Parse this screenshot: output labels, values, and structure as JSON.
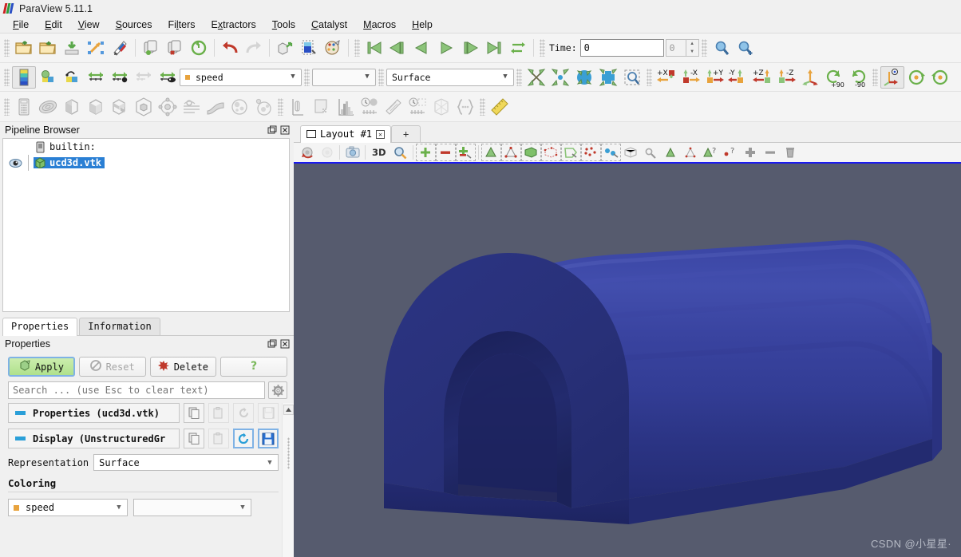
{
  "window": {
    "title": "ParaView 5.11.1",
    "logo_icon": "paraview-logo-icon"
  },
  "menubar": {
    "items": [
      {
        "label": "File",
        "mnemonic": "F"
      },
      {
        "label": "Edit",
        "mnemonic": "E"
      },
      {
        "label": "View",
        "mnemonic": "V"
      },
      {
        "label": "Sources",
        "mnemonic": "S"
      },
      {
        "label": "Filters",
        "mnemonic": "l"
      },
      {
        "label": "Extractors",
        "mnemonic": "x"
      },
      {
        "label": "Tools",
        "mnemonic": "T"
      },
      {
        "label": "Catalyst",
        "mnemonic": "C"
      },
      {
        "label": "Macros",
        "mnemonic": "M"
      },
      {
        "label": "Help",
        "mnemonic": "H"
      }
    ]
  },
  "main_toolbar": {
    "buttons": [
      {
        "name": "open-file-icon",
        "tip": "Open"
      },
      {
        "name": "open-recent-icon",
        "tip": "Recent Files"
      },
      {
        "name": "save-data-icon",
        "tip": "Save Data"
      },
      {
        "name": "save-state-icon",
        "tip": "Save State"
      },
      {
        "name": "save-screenshot-icon",
        "tip": "Save Screenshot"
      },
      {
        "name": "connect-server-icon",
        "tip": "Connect"
      },
      {
        "name": "disconnect-server-icon",
        "tip": "Disconnect"
      },
      {
        "name": "undo-camera-icon",
        "tip": "Reset Camera"
      },
      {
        "name": "undo-icon",
        "tip": "Undo"
      },
      {
        "name": "redo-icon",
        "tip": "Redo"
      },
      {
        "name": "extract-block-icon",
        "tip": "Extract"
      },
      {
        "name": "color-map-editor-icon",
        "tip": "Color Map Editor"
      },
      {
        "name": "edit-color-legend-icon",
        "tip": "Edit Color Legend"
      }
    ],
    "vcr": [
      {
        "name": "first-frame-icon",
        "tip": "First Frame"
      },
      {
        "name": "previous-frame-icon",
        "tip": "Previous Frame"
      },
      {
        "name": "play-reverse-icon",
        "tip": "Play Reverse"
      },
      {
        "name": "play-icon",
        "tip": "Play"
      },
      {
        "name": "next-frame-icon",
        "tip": "Next Frame"
      },
      {
        "name": "last-frame-icon",
        "tip": "Last Frame"
      },
      {
        "name": "loop-icon",
        "tip": "Loop"
      }
    ],
    "time": {
      "label": "Time:",
      "value": "0",
      "frame_index": "0"
    },
    "magnifiers": [
      {
        "name": "zoom-to-data-icon"
      },
      {
        "name": "zoom-closest-to-data-icon"
      }
    ]
  },
  "representation_toolbar": {
    "icons": [
      {
        "name": "toggle-color-legend-icon",
        "checked": true
      },
      {
        "name": "edit-color-map-icon",
        "checked": false
      },
      {
        "name": "rescale-to-data-range-icon",
        "checked": false
      },
      {
        "name": "rescale-custom-range-icon",
        "checked": false
      },
      {
        "name": "rescale-to-data-range-over-time-icon",
        "checked": false
      },
      {
        "name": "rescale-to-visible-range-icon",
        "checked": false,
        "disabled": true
      },
      {
        "name": "rescale-temporal-range-icon",
        "checked": false
      }
    ],
    "array_combo": {
      "value": "speed",
      "dot_color": "#e8a33d"
    },
    "component_combo": {
      "value": ""
    },
    "representation_combo": {
      "value": "Surface"
    },
    "camera_icons": [
      {
        "name": "zoom-to-box-icon"
      },
      {
        "name": "zoom-to-data-icon"
      },
      {
        "name": "reset-camera-icon"
      },
      {
        "name": "reset-camera-closest-icon"
      },
      {
        "name": "zoom-to-selection-icon"
      }
    ],
    "axis_buttons": [
      {
        "name": "set-view-plus-x-icon",
        "label": "+X"
      },
      {
        "name": "set-view-minus-x-icon",
        "label": "-X"
      },
      {
        "name": "set-view-plus-y-icon",
        "label": "+Y"
      },
      {
        "name": "set-view-minus-y-icon",
        "label": "-Y"
      },
      {
        "name": "set-view-plus-z-icon",
        "label": "+Z"
      },
      {
        "name": "set-view-minus-z-icon",
        "label": "-Z"
      },
      {
        "name": "set-view-isometric-icon",
        "label": ""
      },
      {
        "name": "rotate-plus-90-icon",
        "label": "+90"
      },
      {
        "name": "rotate-minus-90-icon",
        "label": "-90"
      }
    ],
    "center_icons": [
      {
        "name": "show-center-axes-icon",
        "checked": true
      },
      {
        "name": "reset-center-icon",
        "checked": false
      },
      {
        "name": "pick-center-icon",
        "checked": false
      }
    ]
  },
  "filters_toolbar": {
    "icons": [
      {
        "name": "calculator-filter-icon"
      },
      {
        "name": "contour-filter-icon"
      },
      {
        "name": "clip-filter-icon"
      },
      {
        "name": "slice-filter-icon"
      },
      {
        "name": "threshold-filter-icon"
      },
      {
        "name": "extract-subset-filter-icon"
      },
      {
        "name": "glyph-filter-icon"
      },
      {
        "name": "stream-tracer-filter-icon"
      },
      {
        "name": "warp-filter-icon"
      },
      {
        "name": "group-datasets-filter-icon"
      },
      {
        "name": "extract-level-filter-icon"
      },
      {
        "name": "plot-over-line-icon"
      },
      {
        "name": "plot-selection-over-time-icon"
      },
      {
        "name": "histogram-icon"
      },
      {
        "name": "plot-data-over-time-icon"
      },
      {
        "name": "plot-data-icon"
      },
      {
        "name": "plot-time-icon"
      },
      {
        "name": "python-calculator-icon"
      },
      {
        "name": "programmable-filter-icon"
      },
      {
        "name": "ruler-icon"
      }
    ]
  },
  "pipeline_browser": {
    "title": "Pipeline Browser",
    "undock_icon": "undock-icon",
    "close_icon": "close-icon",
    "nodes": [
      {
        "label": "builtin:",
        "icon": "server-icon",
        "selected": false,
        "visible": false,
        "indent": 1
      },
      {
        "label": "ucd3d.vtk",
        "icon": "unstructured-grid-icon",
        "selected": true,
        "visible": true,
        "indent": 1
      }
    ]
  },
  "properties_panel": {
    "tabs": [
      {
        "label": "Properties",
        "active": true
      },
      {
        "label": "Information",
        "active": false
      }
    ],
    "title": "Properties",
    "undock_icon": "undock-icon",
    "close_icon": "close-icon",
    "buttons": [
      {
        "name": "apply-button",
        "label": "Apply",
        "icon": "apply-icon",
        "state": "enabled-accent"
      },
      {
        "name": "reset-button",
        "label": "Reset",
        "icon": "reset-icon",
        "state": "disabled"
      },
      {
        "name": "delete-button",
        "label": "Delete",
        "icon": "delete-icon",
        "state": "enabled"
      },
      {
        "name": "help-button",
        "label": "",
        "icon": "question-icon",
        "state": "enabled"
      }
    ],
    "search": {
      "placeholder": "Search ... (use Esc to clear text)",
      "value": "",
      "gear_icon": "gear-icon"
    },
    "groups": [
      {
        "name": "properties-group",
        "label": "Properties (ucd3d.vtk)",
        "minus_color": "#2a9fd8",
        "actions": [
          {
            "name": "copy-icon",
            "dim": false,
            "active": false
          },
          {
            "name": "paste-icon",
            "dim": true,
            "active": false
          },
          {
            "name": "restore-defaults-icon",
            "dim": true,
            "active": false
          },
          {
            "name": "save-as-defaults-icon",
            "dim": true,
            "active": false
          }
        ]
      },
      {
        "name": "display-group",
        "label": "Display (UnstructuredGr",
        "minus_color": "#2a9fd8",
        "actions": [
          {
            "name": "copy-icon",
            "dim": false,
            "active": false
          },
          {
            "name": "paste-icon",
            "dim": true,
            "active": false
          },
          {
            "name": "restore-defaults-icon",
            "dim": false,
            "active": true
          },
          {
            "name": "save-as-defaults-icon",
            "dim": false,
            "active": true
          }
        ]
      }
    ],
    "representation": {
      "label": "Representation",
      "value": "Surface"
    },
    "coloring": {
      "header": "Coloring",
      "array": {
        "value": "speed",
        "dot_color": "#e8a33d"
      },
      "component": {
        "value": ""
      }
    },
    "scrollbar": {
      "up_arrow_icon": "scroll-up-icon"
    }
  },
  "layout": {
    "tabs": [
      {
        "label": "Layout #1",
        "icon": "layout-icon",
        "close_icon": "close-icon",
        "active": true
      },
      {
        "label": "+",
        "icon": "",
        "close_icon": "",
        "active": false
      }
    ]
  },
  "view_toolbar": {
    "left_icons": [
      {
        "name": "undo-camera-icon",
        "dim": false
      },
      {
        "name": "redo-camera-icon",
        "dim": true
      },
      {
        "name": "camera-link-icon",
        "dim": false
      }
    ],
    "mode_label": "3D",
    "zoom_icon": "select-zoom-icon",
    "selection_icons": [
      {
        "name": "add-selection-icon"
      },
      {
        "name": "subtract-selection-icon"
      },
      {
        "name": "toggle-selection-icon"
      },
      {
        "name": "select-cells-surface-icon"
      },
      {
        "name": "select-points-surface-icon"
      },
      {
        "name": "select-cells-frustum-icon"
      },
      {
        "name": "select-points-frustum-icon"
      },
      {
        "name": "select-cells-polygon-icon"
      },
      {
        "name": "select-points-polygon-icon"
      },
      {
        "name": "select-blocks-icon"
      },
      {
        "name": "interactive-select-cells-icon"
      },
      {
        "name": "hover-cells-icon"
      },
      {
        "name": "hover-points-icon"
      },
      {
        "name": "interactive-select-points-icon"
      },
      {
        "name": "query-cells-icon"
      },
      {
        "name": "query-points-icon"
      },
      {
        "name": "grow-selection-icon"
      },
      {
        "name": "shrink-selection-icon"
      },
      {
        "name": "clear-selection-icon"
      }
    ]
  },
  "render_view": {
    "background_color": "#565b6e",
    "object": {
      "name": "ucd3d-tunnel-mesh",
      "surface_color": "#2f3a8f",
      "highlight_color": "#404bb0",
      "shadow_color": "#1f2763"
    },
    "watermark": "CSDN @小星星·"
  }
}
